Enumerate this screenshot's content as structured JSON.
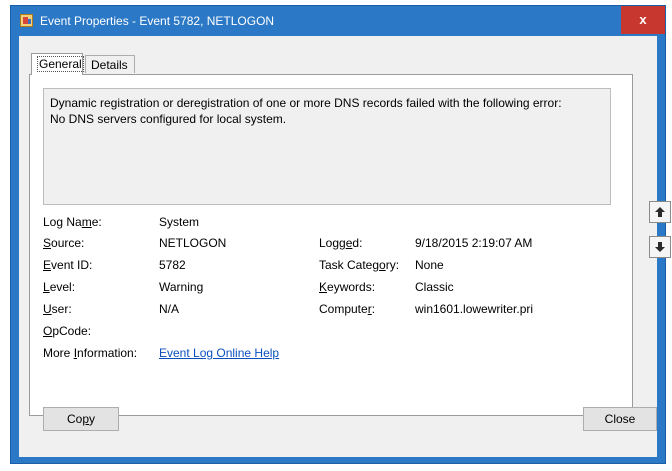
{
  "window": {
    "title": "Event Properties - Event 5782, NETLOGON",
    "close_glyph": "x"
  },
  "tabs": [
    {
      "label": "General",
      "active": true
    },
    {
      "label": "Details",
      "active": false
    }
  ],
  "description": {
    "line1": "Dynamic registration or deregistration of one or more DNS records failed with the following error:",
    "line2": "No DNS servers configured for local system."
  },
  "fields": {
    "log_name": {
      "label_a": "Log Na",
      "label_u": "m",
      "label_b": "e:",
      "value": "System"
    },
    "source": {
      "label_a": "",
      "label_u": "S",
      "label_b": "ource:",
      "value": "NETLOGON"
    },
    "event_id": {
      "label_a": "",
      "label_u": "E",
      "label_b": "vent ID:",
      "value": "5782"
    },
    "level": {
      "label_a": "",
      "label_u": "L",
      "label_b": "evel:",
      "value": "Warning"
    },
    "user": {
      "label_a": "",
      "label_u": "U",
      "label_b": "ser:",
      "value": "N/A"
    },
    "opcode": {
      "label_a": "",
      "label_u": "O",
      "label_b": "pCode:",
      "value": ""
    },
    "more_info": {
      "label_a": "More ",
      "label_u": "I",
      "label_b": "nformation:",
      "value": "Event Log Online Help"
    },
    "logged": {
      "label_a": "Logg",
      "label_u": "e",
      "label_b": "d:",
      "value": "9/18/2015 2:19:07 AM"
    },
    "task_category": {
      "label_a": "Task Categ",
      "label_u": "o",
      "label_b": "ry:",
      "value": "None"
    },
    "keywords": {
      "label_a": "",
      "label_u": "K",
      "label_b": "eywords:",
      "value": "Classic"
    },
    "computer": {
      "label_a": "Compute",
      "label_u": "r",
      "label_b": ":",
      "value": "win1601.lowewriter.pri"
    }
  },
  "buttons": {
    "copy": {
      "label_a": "Co",
      "label_u": "p",
      "label_b": "y"
    },
    "close": {
      "label": "Close"
    }
  },
  "icons": {
    "up": "arrow-up-icon",
    "down": "arrow-down-icon"
  },
  "colors": {
    "title_bar": "#2b78c6",
    "close_button": "#c7372f",
    "link": "#0b4fbf"
  }
}
